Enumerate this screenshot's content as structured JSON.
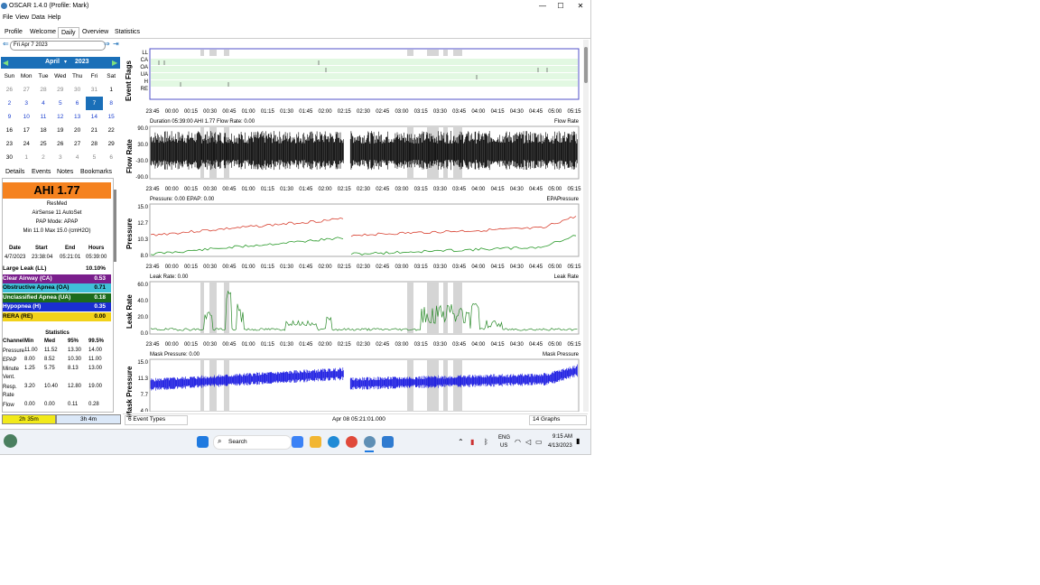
{
  "window": {
    "title": "OSCAR 1.4.0 (Profile: Mark)",
    "controls": [
      "—",
      "☐",
      "✕"
    ]
  },
  "menu": [
    "File",
    "View",
    "Data",
    "Help"
  ],
  "tabs": [
    "Profile",
    "Welcome",
    "Daily",
    "Overview",
    "Statistics"
  ],
  "active_tab": "Daily",
  "date_nav": {
    "value": "Fri Apr 7 2023"
  },
  "calendar": {
    "month": "April",
    "year": "2023",
    "day_headers": [
      "Sun",
      "Mon",
      "Tue",
      "Wed",
      "Thu",
      "Fri",
      "Sat"
    ],
    "weeks": [
      [
        "26",
        "27",
        "28",
        "29",
        "30",
        "31",
        "1"
      ],
      [
        "2",
        "3",
        "4",
        "5",
        "6",
        "7",
        "8"
      ],
      [
        "9",
        "10",
        "11",
        "12",
        "13",
        "14",
        "15"
      ],
      [
        "16",
        "17",
        "18",
        "19",
        "20",
        "21",
        "22"
      ],
      [
        "23",
        "24",
        "25",
        "26",
        "27",
        "28",
        "29"
      ],
      [
        "30",
        "1",
        "2",
        "3",
        "4",
        "5",
        "6"
      ]
    ],
    "selected": "7"
  },
  "subtabs": [
    "Details",
    "Events",
    "Notes",
    "Bookmarks"
  ],
  "ahi": "AHI 1.77",
  "machine": {
    "brand": "ResMed",
    "model": "AirSense 11 AutoSet",
    "mode": "PAP Mode: APAP",
    "range": "Min 11.0 Max 15.0 (cmH2O)"
  },
  "session": {
    "headers": [
      "Date",
      "Start",
      "End",
      "Hours"
    ],
    "row": [
      "4/7/2023",
      "23:38:04",
      "05:21:01",
      "05:39:00"
    ]
  },
  "events": [
    {
      "label": "Large Leak (LL)",
      "value": "10.10%",
      "bg": "#ffffff",
      "fg": "#000000"
    },
    {
      "label": "Clear Airway (CA)",
      "value": "0.53",
      "bg": "#7a1e8c",
      "fg": "#ffffff"
    },
    {
      "label": "Obstructive Apnea (OA)",
      "value": "0.71",
      "bg": "#40c0d8",
      "fg": "#000000"
    },
    {
      "label": "Unclassified Apnea (UA)",
      "value": "0.18",
      "bg": "#1c6b1c",
      "fg": "#ffffff"
    },
    {
      "label": "Hypopnea (H)",
      "value": "0.35",
      "bg": "#1a2ed0",
      "fg": "#ffffff"
    },
    {
      "label": "RERA (RE)",
      "value": "0.00",
      "bg": "#f2d21a",
      "fg": "#000000"
    }
  ],
  "statistics": {
    "title": "Statistics",
    "headers": [
      "Channel",
      "Min",
      "Med",
      "95%",
      "99.5%"
    ],
    "rows": [
      [
        "Pressure",
        "11.00",
        "11.52",
        "13.30",
        "14.00"
      ],
      [
        "EPAP",
        "8.00",
        "8.52",
        "10.30",
        "11.00"
      ],
      [
        "Minute Vent.",
        "1.25",
        "5.75",
        "8.13",
        "13.00"
      ],
      [
        "Resp. Rate",
        "3.20",
        "10.40",
        "12.80",
        "19.00"
      ],
      [
        "Flow",
        "0.00",
        "0.00",
        "0.11",
        "0.28"
      ]
    ]
  },
  "duration": {
    "left": "2h 35m",
    "right": "3h 4m"
  },
  "graphs": {
    "times": [
      "23:45",
      "00:00",
      "00:15",
      "00:30",
      "00:45",
      "01:00",
      "01:15",
      "01:30",
      "01:45",
      "02:00",
      "02:15",
      "02:30",
      "02:45",
      "03:00",
      "03:15",
      "03:30",
      "03:45",
      "04:00",
      "04:15",
      "04:30",
      "04:45",
      "05:00",
      "05:15"
    ],
    "event_flags": {
      "ylabel": "Event Flags",
      "rows": [
        "LL",
        "CA",
        "OA",
        "UA",
        "H",
        "RE"
      ]
    },
    "flow": {
      "ylabel": "Flow Rate",
      "info": "Duration 05:39:00 AHI 1.77 Flow Rate: 0.00",
      "legend": "Flow Rate",
      "yticks": [
        "90.0",
        "30.0",
        "-30.0",
        "-90.0"
      ]
    },
    "pressure": {
      "ylabel": "Pressure",
      "info": "Pressure: 0.00  EPAP: 0.00",
      "legend": [
        "EPAP",
        "Pressure"
      ],
      "yticks": [
        "15.0",
        "12.7",
        "10.3",
        "8.0"
      ]
    },
    "leak": {
      "ylabel": "Leak Rate",
      "info": "Leak Rate: 0.00",
      "legend": "Leak Rate",
      "yticks": [
        "60.0",
        "40.0",
        "20.0",
        "0.0"
      ]
    },
    "mask": {
      "ylabel": "Mask Pressure",
      "info": "Mask Pressure: 0.00",
      "legend": "Mask Pressure",
      "yticks": [
        "15.0",
        "11.3",
        "7.7",
        "4.0"
      ]
    }
  },
  "bottom": {
    "event_types": "6 Event Types",
    "datetime": "Apr 08 05:21:01.000",
    "graphs": "14 Graphs"
  },
  "taskbar": {
    "search": "Search",
    "lang1": "ENG",
    "lang2": "US",
    "time": "9:15 AM",
    "date": "4/13/2023"
  }
}
